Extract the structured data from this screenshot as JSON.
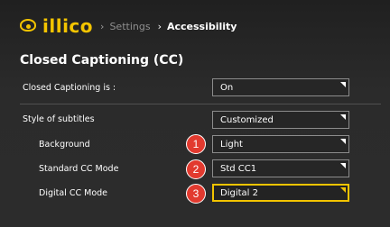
{
  "header": {
    "logo_text": "illico",
    "breadcrumb": [
      "Settings",
      "Accessibility"
    ],
    "separator": "›"
  },
  "section": {
    "title": "Closed Captioning (CC)"
  },
  "rows": [
    {
      "label": "Closed Captioning is :",
      "value": "On"
    },
    {
      "label": "Style of subtitles",
      "value": "Customized"
    },
    {
      "label": "Background",
      "value": "Light",
      "marker": "1"
    },
    {
      "label": "Standard CC Mode",
      "value": "Std CC1",
      "marker": "2"
    },
    {
      "label": "Digital CC Mode",
      "value": "Digital 2",
      "marker": "3"
    }
  ],
  "colors": {
    "accent": "#f3c400",
    "marker": "#e23a2f"
  }
}
